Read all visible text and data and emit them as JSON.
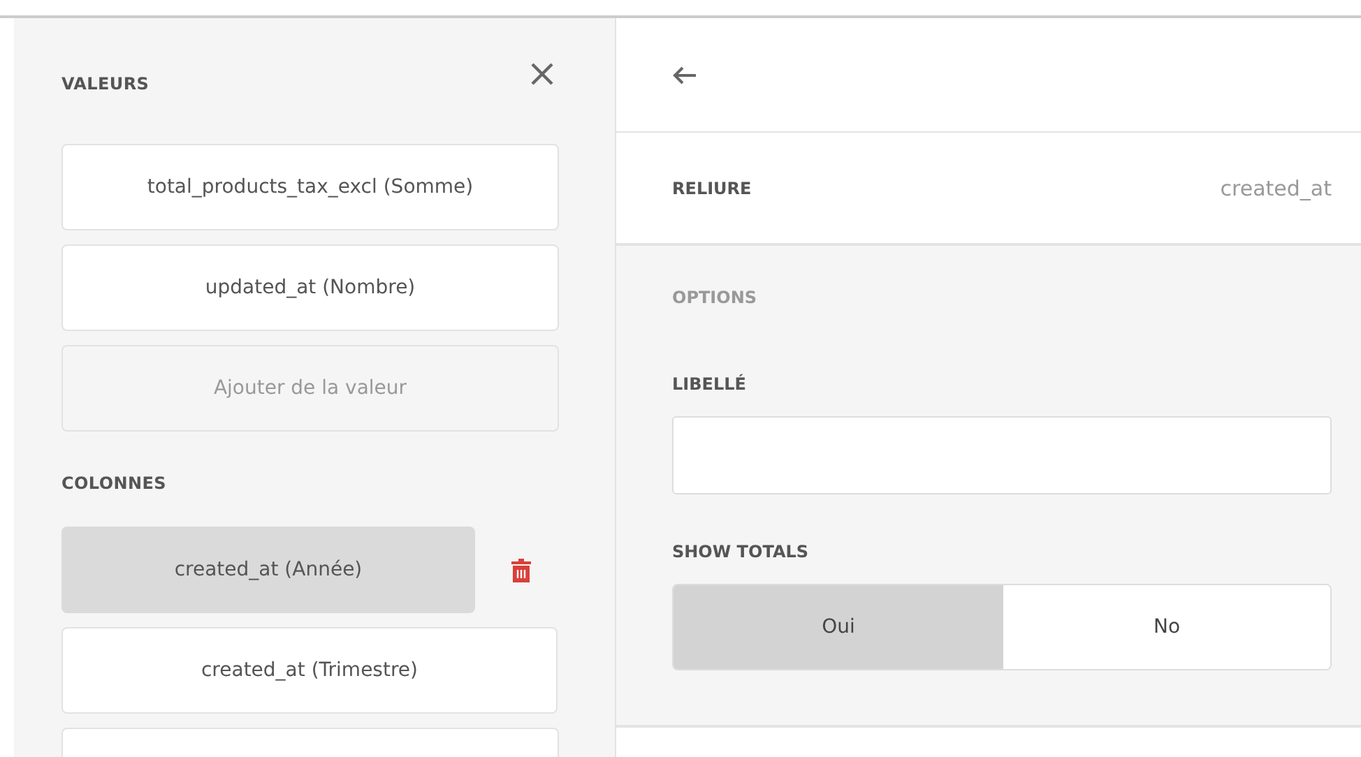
{
  "left_panel": {
    "values_heading": "VALEURS",
    "values": [
      {
        "label": "total_products_tax_excl (Somme)",
        "kind": "item"
      },
      {
        "label": "updated_at (Nombre)",
        "kind": "item"
      },
      {
        "label": "Ajouter de la valeur",
        "kind": "add"
      }
    ],
    "columns_heading": "COLONNES",
    "columns": [
      {
        "label": "created_at (Année)",
        "selected": true
      },
      {
        "label": "created_at (Trimestre)",
        "selected": false
      }
    ]
  },
  "right_panel": {
    "binding": {
      "label": "RELIURE",
      "value": "created_at"
    },
    "options_heading": "OPTIONS",
    "label_field": {
      "label": "LIBELLÉ"
    },
    "show_totals": {
      "label": "SHOW TOTALS",
      "options": [
        {
          "label": "Oui",
          "selected": true
        },
        {
          "label": "No",
          "selected": false
        }
      ]
    }
  }
}
